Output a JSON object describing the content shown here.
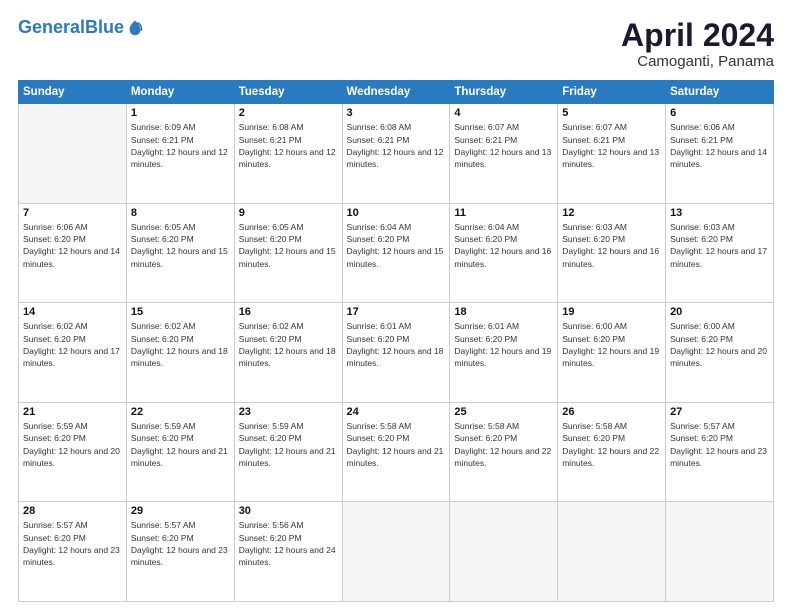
{
  "header": {
    "logo_line1": "General",
    "logo_line2": "Blue",
    "month": "April 2024",
    "location": "Camoganti, Panama"
  },
  "weekdays": [
    "Sunday",
    "Monday",
    "Tuesday",
    "Wednesday",
    "Thursday",
    "Friday",
    "Saturday"
  ],
  "weeks": [
    [
      {
        "day": "",
        "sunrise": "",
        "sunset": "",
        "daylight": ""
      },
      {
        "day": "1",
        "sunrise": "Sunrise: 6:09 AM",
        "sunset": "Sunset: 6:21 PM",
        "daylight": "Daylight: 12 hours and 12 minutes."
      },
      {
        "day": "2",
        "sunrise": "Sunrise: 6:08 AM",
        "sunset": "Sunset: 6:21 PM",
        "daylight": "Daylight: 12 hours and 12 minutes."
      },
      {
        "day": "3",
        "sunrise": "Sunrise: 6:08 AM",
        "sunset": "Sunset: 6:21 PM",
        "daylight": "Daylight: 12 hours and 12 minutes."
      },
      {
        "day": "4",
        "sunrise": "Sunrise: 6:07 AM",
        "sunset": "Sunset: 6:21 PM",
        "daylight": "Daylight: 12 hours and 13 minutes."
      },
      {
        "day": "5",
        "sunrise": "Sunrise: 6:07 AM",
        "sunset": "Sunset: 6:21 PM",
        "daylight": "Daylight: 12 hours and 13 minutes."
      },
      {
        "day": "6",
        "sunrise": "Sunrise: 6:06 AM",
        "sunset": "Sunset: 6:21 PM",
        "daylight": "Daylight: 12 hours and 14 minutes."
      }
    ],
    [
      {
        "day": "7",
        "sunrise": "Sunrise: 6:06 AM",
        "sunset": "Sunset: 6:20 PM",
        "daylight": "Daylight: 12 hours and 14 minutes."
      },
      {
        "day": "8",
        "sunrise": "Sunrise: 6:05 AM",
        "sunset": "Sunset: 6:20 PM",
        "daylight": "Daylight: 12 hours and 15 minutes."
      },
      {
        "day": "9",
        "sunrise": "Sunrise: 6:05 AM",
        "sunset": "Sunset: 6:20 PM",
        "daylight": "Daylight: 12 hours and 15 minutes."
      },
      {
        "day": "10",
        "sunrise": "Sunrise: 6:04 AM",
        "sunset": "Sunset: 6:20 PM",
        "daylight": "Daylight: 12 hours and 15 minutes."
      },
      {
        "day": "11",
        "sunrise": "Sunrise: 6:04 AM",
        "sunset": "Sunset: 6:20 PM",
        "daylight": "Daylight: 12 hours and 16 minutes."
      },
      {
        "day": "12",
        "sunrise": "Sunrise: 6:03 AM",
        "sunset": "Sunset: 6:20 PM",
        "daylight": "Daylight: 12 hours and 16 minutes."
      },
      {
        "day": "13",
        "sunrise": "Sunrise: 6:03 AM",
        "sunset": "Sunset: 6:20 PM",
        "daylight": "Daylight: 12 hours and 17 minutes."
      }
    ],
    [
      {
        "day": "14",
        "sunrise": "Sunrise: 6:02 AM",
        "sunset": "Sunset: 6:20 PM",
        "daylight": "Daylight: 12 hours and 17 minutes."
      },
      {
        "day": "15",
        "sunrise": "Sunrise: 6:02 AM",
        "sunset": "Sunset: 6:20 PM",
        "daylight": "Daylight: 12 hours and 18 minutes."
      },
      {
        "day": "16",
        "sunrise": "Sunrise: 6:02 AM",
        "sunset": "Sunset: 6:20 PM",
        "daylight": "Daylight: 12 hours and 18 minutes."
      },
      {
        "day": "17",
        "sunrise": "Sunrise: 6:01 AM",
        "sunset": "Sunset: 6:20 PM",
        "daylight": "Daylight: 12 hours and 18 minutes."
      },
      {
        "day": "18",
        "sunrise": "Sunrise: 6:01 AM",
        "sunset": "Sunset: 6:20 PM",
        "daylight": "Daylight: 12 hours and 19 minutes."
      },
      {
        "day": "19",
        "sunrise": "Sunrise: 6:00 AM",
        "sunset": "Sunset: 6:20 PM",
        "daylight": "Daylight: 12 hours and 19 minutes."
      },
      {
        "day": "20",
        "sunrise": "Sunrise: 6:00 AM",
        "sunset": "Sunset: 6:20 PM",
        "daylight": "Daylight: 12 hours and 20 minutes."
      }
    ],
    [
      {
        "day": "21",
        "sunrise": "Sunrise: 5:59 AM",
        "sunset": "Sunset: 6:20 PM",
        "daylight": "Daylight: 12 hours and 20 minutes."
      },
      {
        "day": "22",
        "sunrise": "Sunrise: 5:59 AM",
        "sunset": "Sunset: 6:20 PM",
        "daylight": "Daylight: 12 hours and 21 minutes."
      },
      {
        "day": "23",
        "sunrise": "Sunrise: 5:59 AM",
        "sunset": "Sunset: 6:20 PM",
        "daylight": "Daylight: 12 hours and 21 minutes."
      },
      {
        "day": "24",
        "sunrise": "Sunrise: 5:58 AM",
        "sunset": "Sunset: 6:20 PM",
        "daylight": "Daylight: 12 hours and 21 minutes."
      },
      {
        "day": "25",
        "sunrise": "Sunrise: 5:58 AM",
        "sunset": "Sunset: 6:20 PM",
        "daylight": "Daylight: 12 hours and 22 minutes."
      },
      {
        "day": "26",
        "sunrise": "Sunrise: 5:58 AM",
        "sunset": "Sunset: 6:20 PM",
        "daylight": "Daylight: 12 hours and 22 minutes."
      },
      {
        "day": "27",
        "sunrise": "Sunrise: 5:57 AM",
        "sunset": "Sunset: 6:20 PM",
        "daylight": "Daylight: 12 hours and 23 minutes."
      }
    ],
    [
      {
        "day": "28",
        "sunrise": "Sunrise: 5:57 AM",
        "sunset": "Sunset: 6:20 PM",
        "daylight": "Daylight: 12 hours and 23 minutes."
      },
      {
        "day": "29",
        "sunrise": "Sunrise: 5:57 AM",
        "sunset": "Sunset: 6:20 PM",
        "daylight": "Daylight: 12 hours and 23 minutes."
      },
      {
        "day": "30",
        "sunrise": "Sunrise: 5:56 AM",
        "sunset": "Sunset: 6:20 PM",
        "daylight": "Daylight: 12 hours and 24 minutes."
      },
      {
        "day": "",
        "sunrise": "",
        "sunset": "",
        "daylight": ""
      },
      {
        "day": "",
        "sunrise": "",
        "sunset": "",
        "daylight": ""
      },
      {
        "day": "",
        "sunrise": "",
        "sunset": "",
        "daylight": ""
      },
      {
        "day": "",
        "sunrise": "",
        "sunset": "",
        "daylight": ""
      }
    ]
  ]
}
